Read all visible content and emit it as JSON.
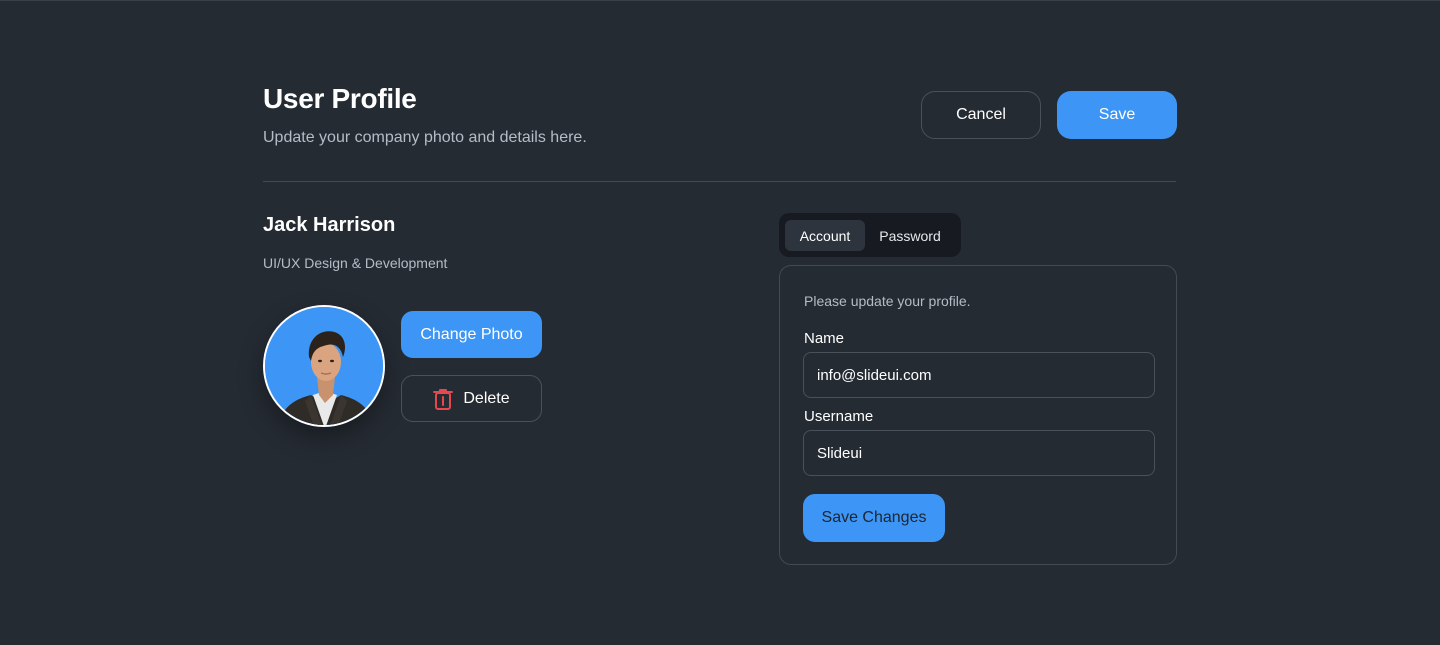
{
  "header": {
    "title": "User Profile",
    "subtitle": "Update your company photo and details here.",
    "cancel_label": "Cancel",
    "save_label": "Save"
  },
  "profile": {
    "name": "Jack Harrison",
    "role": "UI/UX Design & Development",
    "change_photo_label": "Change Photo",
    "delete_label": "Delete"
  },
  "tabs": [
    {
      "label": "Account",
      "active": true
    },
    {
      "label": "Password",
      "active": false
    }
  ],
  "form": {
    "hint": "Please update your profile.",
    "name_label": "Name",
    "name_value": "info@slideui.com",
    "username_label": "Username",
    "username_value": "Slideui",
    "submit_label": "Save Changes"
  },
  "colors": {
    "background": "#252b33",
    "accent": "#3d96f5",
    "danger": "#e5484d"
  },
  "icons": {
    "delete": "trash-icon"
  }
}
